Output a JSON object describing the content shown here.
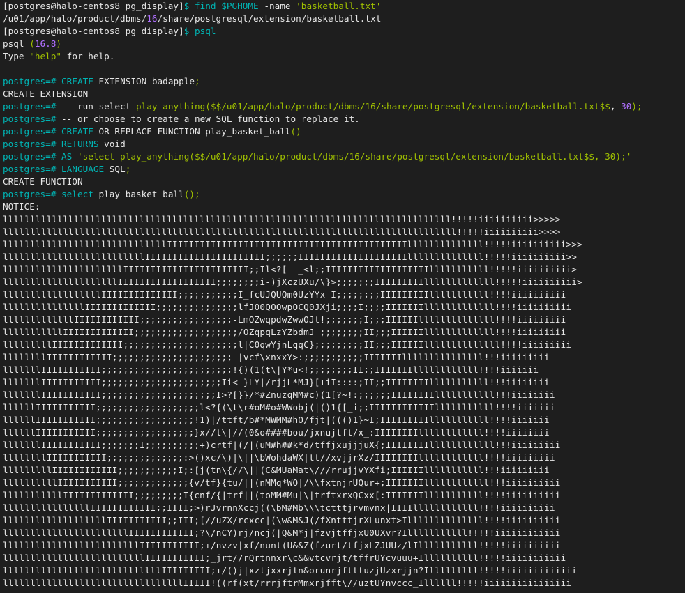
{
  "theme": {
    "bg": "#1e1e1e",
    "fg": "#e6e6e6",
    "keyword": "#00b4b4",
    "string": "#a0c000",
    "number": "#b070ff",
    "art_fg": "#e6e6e6"
  },
  "lines": [
    [
      [
        "[postgres@halo-centos8 pg_display]",
        "fg"
      ],
      [
        "$ ",
        "kw"
      ],
      [
        "find ",
        "kw"
      ],
      [
        "$PGHOME",
        "kw"
      ],
      [
        " -name ",
        "fg"
      ],
      [
        "'basketball.txt'",
        "str"
      ]
    ],
    [
      [
        "/u01/app/halo/product/dbms/",
        "fg"
      ],
      [
        "16",
        "num"
      ],
      [
        "/share/postgresql/extension/basketball.txt",
        "fg"
      ]
    ],
    [
      [
        "[postgres@halo-centos8 pg_display]",
        "fg"
      ],
      [
        "$ ",
        "kw"
      ],
      [
        "psql",
        "kw"
      ]
    ],
    [
      [
        "psql ",
        "fg"
      ],
      [
        "(",
        "str"
      ],
      [
        "16.8",
        "num"
      ],
      [
        ")",
        "str"
      ]
    ],
    [
      [
        "Type ",
        "fg"
      ],
      [
        "\"help\"",
        "str"
      ],
      [
        " for help.",
        "fg"
      ]
    ],
    [
      [
        "",
        "fg"
      ]
    ],
    [
      [
        "postgres=# ",
        "kw"
      ],
      [
        "CREATE",
        "kw"
      ],
      [
        " EXTENSION badapple",
        "fg"
      ],
      [
        ";",
        "str"
      ]
    ],
    [
      [
        "CREATE EXTENSION",
        "fg"
      ]
    ],
    [
      [
        "postgres=# ",
        "kw"
      ],
      [
        "-- run select ",
        "fg"
      ],
      [
        "play_anything(",
        "str"
      ],
      [
        "$$/u01/app/halo/product/dbms/16/share/postgresql/extension/basketball.txt$$",
        "str"
      ],
      [
        ", ",
        "fg"
      ],
      [
        "30",
        "num"
      ],
      [
        ");",
        "str"
      ]
    ],
    [
      [
        "postgres=# ",
        "kw"
      ],
      [
        "-- or choose to create a new SQL function to replace it.",
        "fg"
      ]
    ],
    [
      [
        "postgres=# ",
        "kw"
      ],
      [
        "CREATE",
        "kw"
      ],
      [
        " OR REPLACE FUNCTION play_basket_ball",
        "fg"
      ],
      [
        "()",
        "str"
      ]
    ],
    [
      [
        "postgres=# ",
        "kw"
      ],
      [
        "RETURNS",
        "kw"
      ],
      [
        " void",
        "fg"
      ]
    ],
    [
      [
        "postgres=# ",
        "kw"
      ],
      [
        "AS ",
        "kw"
      ],
      [
        "'select play_anything($$/u01/app/halo/product/dbms/16/share/postgresql/extension/basketball.txt$$, 30);'",
        "str"
      ]
    ],
    [
      [
        "postgres=# ",
        "kw"
      ],
      [
        "LANGUAGE",
        "kw"
      ],
      [
        " SQL",
        "fg"
      ],
      [
        ";",
        "str"
      ]
    ],
    [
      [
        "CREATE FUNCTION",
        "fg"
      ]
    ],
    [
      [
        "postgres=# ",
        "kw"
      ],
      [
        "select",
        "kw"
      ],
      [
        " play_basket_ball",
        "fg"
      ],
      [
        "();",
        "str"
      ]
    ],
    [
      [
        "NOTICE:",
        "fg"
      ]
    ]
  ],
  "art": [
    "llllllllllllllllllllllllllllllllllllllllllllllllllllllllllllllllllllllllllllllllll!!!!!iiiiiiiiii>>>>>",
    "lllllllllllllllllllllllllllllllllllllllllllllllllllllllllllllllllllllllllllllllllll!!!!!iiiiiiiiii>>>>",
    "llllllllllllllllllllllllllllllIIIIIIIIIIIIIIIIIIIIIIIIIIIIIIIIIIIIIIIIIIIIllllllllllllll!!!!!iiiiiiiiii>>>",
    "llllllllllllllllllllllllllIIIIIIIIIIIIIIIIIIIIII;;;;;;IIIIIIIIIIIIIIIIIIIIllllllllllllll!!!!!iiiiiiiiii>>",
    "llllllllllllllllllllllIIIIIIIIIIIIIIIIIIIIIII;;Il<?[--_<l;;IIIIIIIIIIIIIIIIIIIlllllllllll!!!!!iiiiiiiiii>",
    "lllllllllllllllllllllIIIIIIIIIIIIIIIIII;;;;;;;;i-)jXczUXu/\\}>;;;;;;;IIIIIIIIIlllllllllllll!!!!!iiiiiiiiii>",
    "llllllllllllllllllIIIIIIIIIIIIII;;;;;;;;;;;I_fcUJQUQm0UzYYx-I;;;;;;;;IIIIIIIIIlllllllllll!!!!iiiiiiiiii",
    "lllllllllllllllIIIIIIIIIIIII;;;;;;;;;;;;;;;lfJ00QOOwpOCQ0JXji;;;;I;;;;IIIIIIIlllllllllllll!!!!iiiiiiiiii",
    "lllllllllllllIIIIIIIIIIII;;;;;;;;;;;;;;;;;-LmOZwqpdwZwwOJt!;;;;;;;I;;;IIIIIIllllllllllllll!!!!iiiiiiiii",
    "lllllllllllIIIIIIIIIIIII;;;;;;;;;;;;;;;;;;;/OZqpqLzYZbdmJ_;;;;;;;;II;;;IIIIIIlllllllllllll!!!!iiiiiiiii",
    "lllllllllIIIIIIIIIIIII;;;;;;;;;;;;;;;;;;;;;l|C0qwYjnLqqC};;;;;;;;;II;;;IIIIIIllllllllllllll!!!!iiiiiiiii",
    "llllllllIIIIIIIIIIII;;;;;;;;;;;;;;;;;;;;;;_|vcf\\xnxxY>:;;;;;;;;;;;IIIIIIIlllllllllllllll!!!iiiiiiiii",
    "lllllllIIIIIIIIIII;;;;;;;;;;;;;;;;;;;;;;;;!{)(1(t\\|Y*u<!;;;;;;;;II;;IIIIIIIllllllllllll!!!!iiiiiii",
    "lllllllIIIIIIIIIII;;;;;;;;;;;;;;;;;;;;;;Ii<-}LY|/rjjL*MJ}[+iI::::;II;;IIIIIIIIlllllllllll!!!iiiiiiii",
    "lllllllIIIIIIIIIII;;;;;;;;;;;;;;;;;;;;;I>?[}}/*#ZnuzqMM#c)(1[?~!:;;;;;;IIIIIIIIlllllllllll!!!iiiiiiii",
    "llllllIIIIIIIIIII;;;;;;;;;;;;;;;;;;;l<?{(\\t\\r#oM#o#WWobj(|()1{[_i;;IIIIIIIIIIIIlllllllllll!!!!iiiiiii",
    "llllllIIIIIIIIIII;;;;;;;;;;;;;;;;;;!1)|/ttft/b#*MWMM#hO/fjt|((()1}~I;IIIIIIIIIlllllllllll!!!!iiiiiii",
    "llllllIIIIIIIIIII;;;;;;;;;;;;;;;;;;}x//t\\|//(0&o####bou/jxnujtft/x_:IIIIIIIIllllllllllll!!!!iiiiiiii",
    "lllllllIIIIIIIIIII;;;;;;;I;;;;;;;;;;+)crtf|(/|(uM#h##k*d/tffjxujjjuX{;IIIIIIIIllllllllllll!!!iiiiiiiii",
    "llllllllIIIIIIIIIII;;;;;;;;;;;;;;:>()xc/\\)|\\||\\bWohdaWX|tt//xvjjrXz/IIIIIIIIllllllllllll!!!!iiiiiiiii",
    "lllllllllIIIIIIIIIIII;;;;;;;;;;;I;:[j(tn\\{//\\||(C&MUaMat\\///rrujjvYXfi;IIIIIIlllllllllll!!!iiiiiiiii",
    "llllllllllIIIIIIIIIII;;;;;;;;;;;;;{v/tf}{tu/||(nMMq*WO|/\\\\fxtnjrUQur+;IIIIIIIllllllllllll!!!iiiiiiiiii",
    "lllllllllllIIIIIIIIIIIII;;;;;;;;;I{cnf/{|trf||(toMM#Mu|\\|trftxrxQCxx[:IIIIIIIlllllllllll!!!!iiiiiiiiii",
    "llllllllllllllllIIIIIIIIIIII;;IIII;>)rJvrnnXccj((\\bM#Mb\\\\\\tctttjrvmvnx|IIIIllllllllllll!!!!iiiiiiiiii",
    "lllllllllllllllllllIIIIIIIIIII;;III;[//uZX/rcxcc|(\\w&M&J(/fXntttjrXLunxt>Illllllllllllll!!!!iiiiiiiiii",
    "lllllllllllllllllllllllIIIIIIIIIIII;?\\/nCY)rj/ncj(|Q&M*j|fzvjtffjxU0UXvr?Illlllllllll!!!!!iiiiiiiiiiii",
    "lllllllllllllllllllllllllIIIIIIIIIII;+/nvzv|xf/nunt(U&&Z(fzurt/tfjxLZJUUz/lIlllllllllll!!!!!iiiiiiiiii",
    "llllllllllllllllllllllllllIIIIIIIIIII;_jrt//rQrtnnxr\\c&&vtcvrjt/tffrUYcvuuu+Illllllllll!!!!!iiiiiiiiiii",
    "lllllllllllllllllllllllllllllIIIIIIIII;+/()j|xztjxxrjtn&orunrjftttuzjUzxrjjn?Illlllllll!!!!!iiiiiiiiiiiii",
    "lllllllllllllllllllllllllllllllllIIIII!((rf(xt/rrrjftrMmxrjfft\\//uztUYnvccc_Illllll!!!!!iiiiiiiiiiiiiiii"
  ]
}
